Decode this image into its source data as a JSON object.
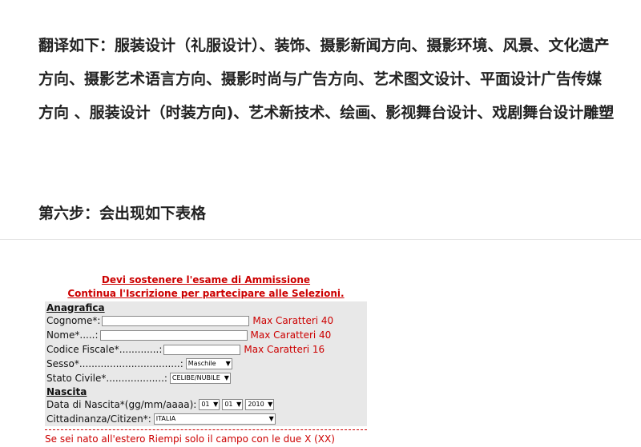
{
  "article": {
    "para1": "翻译如下：服装设计（礼服设计）、装饰、摄影新闻方向、摄影环境、风景、文化遗产方向、摄影艺术语言方向、摄影时尚与广告方向、艺术图文设计、平面设计广告传媒方向 、服装设计（时装方向)、艺术新技术、绘画、影视舞台设计、戏剧舞台设计雕塑",
    "para2": "第六步：会出现如下表格"
  },
  "form": {
    "heading1": "Devi sostenere l'esame di Ammissione",
    "heading2": "Continua l'Iscrizione per partecipare alle Selezioni.",
    "anagrafica": "Anagrafica",
    "cognome_label": "Cognome*:",
    "cognome_hint": "Max Caratteri 40",
    "nome_label": "Nome*.....:",
    "nome_hint": "Max Caratteri 40",
    "cf_label": "Codice Fiscale*.............:",
    "cf_hint": "Max Caratteri 16",
    "sesso_label": "Sesso*.................................:",
    "sesso_value": "Maschile",
    "civile_label": "Stato Civile*...................:",
    "civile_value": "CELIBE/NUBILE",
    "nascita": "Nascita",
    "data_label": "Data di Nascita*(gg/mm/aaaa):",
    "day_value": "01",
    "month_value": "01",
    "year_value": "2010",
    "citt_label": "Cittadinanza/Citizen*:",
    "citt_value": "ITALIA",
    "estero": "Se sei nato all'estero Riempi solo il campo con le due X (XX)"
  }
}
